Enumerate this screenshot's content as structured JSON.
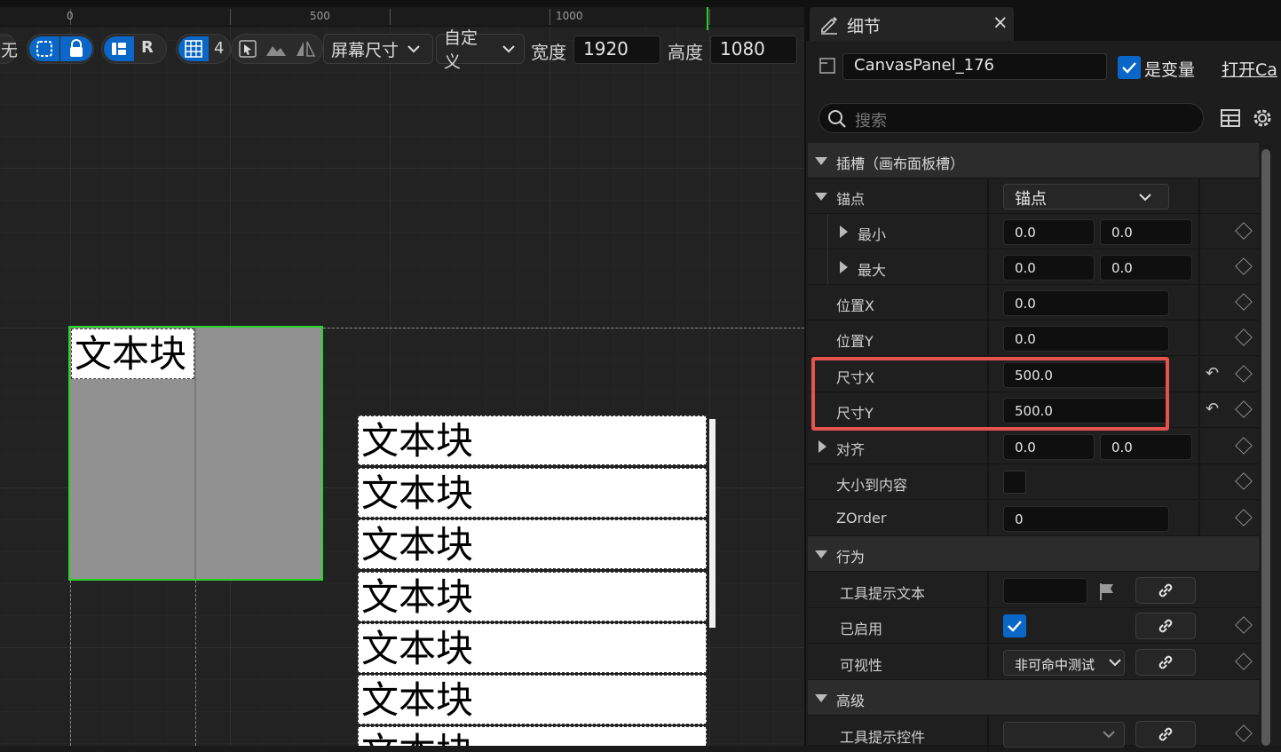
{
  "ruler": {
    "labels": [
      "0",
      "500",
      "1000"
    ]
  },
  "toolbar": {
    "partial_label": "无",
    "r_label": "R",
    "grid_count": "4",
    "screen_size": "屏幕尺寸",
    "custom": "自定义",
    "width_label": "宽度",
    "width_value": "1920",
    "height_label": "高度",
    "height_value": "1080"
  },
  "canvas": {
    "panel_text": "文本块",
    "list_items": [
      "文本块",
      "文本块",
      "文本块",
      "文本块",
      "文本块",
      "文本块",
      "文本块"
    ]
  },
  "details": {
    "tab_title": "细节",
    "close": "×",
    "component_name": "CanvasPanel_176",
    "is_variable": "是变量",
    "open_link": "打开Ca",
    "search_placeholder": "搜索",
    "sections": {
      "slot": "插槽（画布面板槽）",
      "behavior": "行为",
      "advanced": "高级"
    },
    "anchors": {
      "label": "锚点",
      "value": "锚点"
    },
    "min": {
      "label": "最小",
      "x": "0.0",
      "y": "0.0"
    },
    "max": {
      "label": "最大",
      "x": "0.0",
      "y": "0.0"
    },
    "pos_x": {
      "label": "位置X",
      "value": "0.0"
    },
    "pos_y": {
      "label": "位置Y",
      "value": "0.0"
    },
    "size_x": {
      "label": "尺寸X",
      "value": "500.0"
    },
    "size_y": {
      "label": "尺寸Y",
      "value": "500.0"
    },
    "alignment": {
      "label": "对齐",
      "x": "0.0",
      "y": "0.0"
    },
    "size_to_content": {
      "label": "大小到内容"
    },
    "zorder": {
      "label": "ZOrder",
      "value": "0"
    },
    "tooltip_text": {
      "label": "工具提示文本"
    },
    "enabled": {
      "label": "已启用"
    },
    "visibility": {
      "label": "可视性",
      "value": "非可命中测试"
    },
    "tooltip_widget": {
      "label": "工具提示控件"
    }
  },
  "colors": {
    "accent": "#0a67c7",
    "selection_green": "#29d429",
    "highlight_red": "#e6534d"
  }
}
